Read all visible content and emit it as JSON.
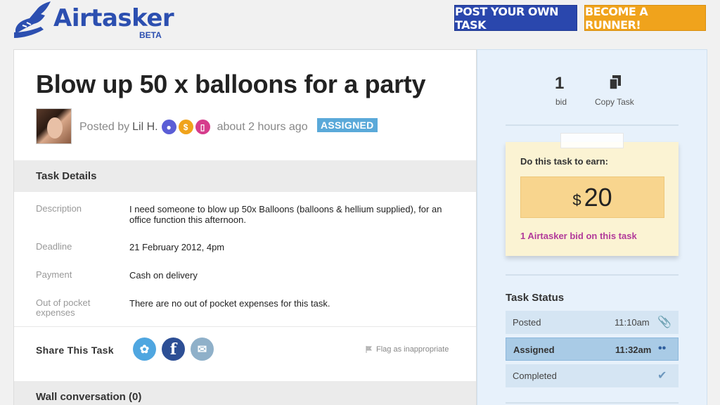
{
  "header": {
    "logo_text": "Airtasker",
    "logo_beta": "BETA",
    "post_task_label": "POST YOUR OWN TASK",
    "become_runner_label": "BECOME A RUNNER!"
  },
  "task": {
    "title": "Blow up 50 x balloons for a party",
    "posted_by_prefix": "Posted by",
    "poster_name": "Lil H.",
    "posted_time": "about 2 hours ago",
    "status_badge": "ASSIGNED",
    "details_heading": "Task Details",
    "details": [
      {
        "label": "Description",
        "value": "I need someone to blow up 50x Balloons (balloons & hellium supplied), for an office function this afternoon."
      },
      {
        "label": "Deadline",
        "value": "21 February 2012, 4pm"
      },
      {
        "label": "Payment",
        "value": "Cash on delivery"
      },
      {
        "label": "Out of pocket expenses",
        "value": "There are no out of pocket expenses for this task."
      }
    ],
    "share_label": "Share This Task",
    "flag_label": "Flag as inappropriate",
    "wall_heading": "Wall conversation (0)"
  },
  "sidebar": {
    "bid_count": "1",
    "bid_label": "bid",
    "copy_label": "Copy Task",
    "earn_label": "Do this task to earn:",
    "currency": "$",
    "price": "20",
    "bids_text": "1 Airtasker bid on this task",
    "status_title": "Task Status",
    "statuses": [
      {
        "name": "Posted",
        "time": "11:10am",
        "icon": "paperclip-icon"
      },
      {
        "name": "Assigned",
        "time": "11:32am",
        "icon": "footprints-icon"
      },
      {
        "name": "Completed",
        "time": "",
        "icon": "checkmark-icon"
      }
    ]
  },
  "colors": {
    "brand_blue": "#2a47ad",
    "brand_orange": "#f0a31c",
    "assigned_badge": "#5aa9d9",
    "bid_text": "#b23a9a"
  }
}
